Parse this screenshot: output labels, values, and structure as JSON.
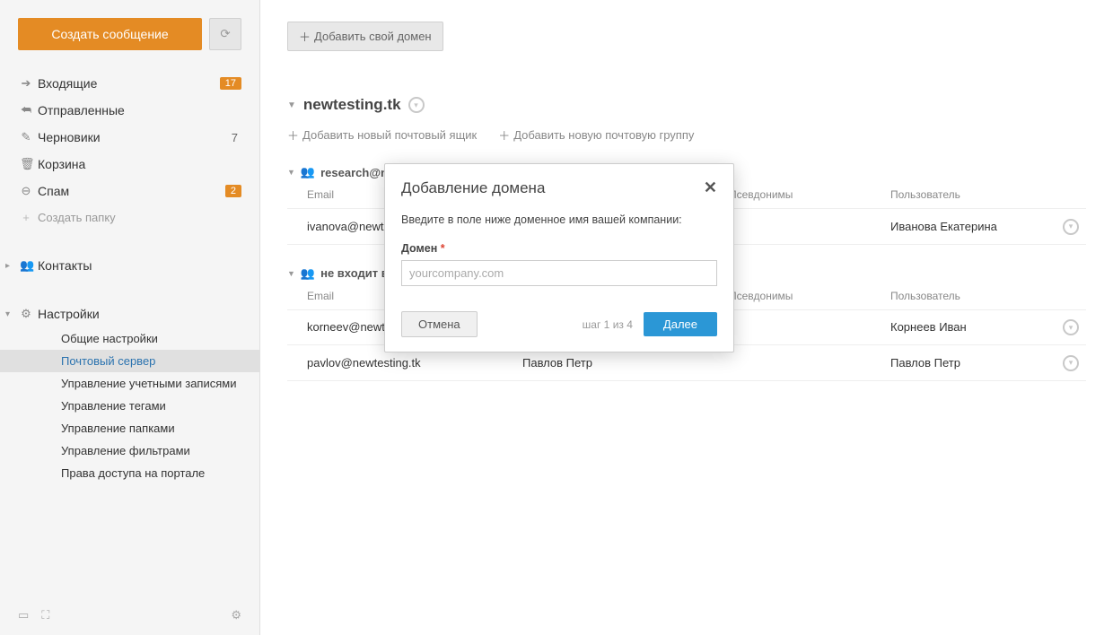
{
  "sidebar": {
    "compose_label": "Создать сообщение",
    "folders": [
      {
        "label": "Входящие",
        "badge": "17",
        "icon": "➡"
      },
      {
        "label": "Отправленные",
        "icon": "↩"
      },
      {
        "label": "Черновики",
        "count": "7",
        "icon": "✎"
      },
      {
        "label": "Корзина",
        "icon": "🗑"
      },
      {
        "label": "Спам",
        "badge": "2",
        "icon": "⊖"
      }
    ],
    "create_folder_label": "Создать папку",
    "contacts_label": "Контакты",
    "settings_label": "Настройки",
    "settings_items": [
      "Общие настройки",
      "Почтовый сервер",
      "Управление учетными записями",
      "Управление тегами",
      "Управление папками",
      "Управление фильтрами",
      "Права доступа на портале"
    ]
  },
  "content": {
    "add_domain_btn": "Добавить свой домен",
    "domain_title": "newtesting.tk",
    "add_mailbox_label": "Добавить новый почтовый ящик",
    "add_group_label": "Добавить новую почтовую группу",
    "columns": {
      "email": "Email",
      "pseudonyms": "Псевдонимы",
      "user": "Пользователь"
    },
    "group1_label": "research@ne",
    "group1_rows": [
      {
        "email": "ivanova@newtes",
        "name": "",
        "user": "Иванова Екатерина"
      }
    ],
    "group2_label": "не входит в",
    "group2_rows": [
      {
        "email": "korneev@newte",
        "name": "",
        "user": "Корнеев Иван"
      },
      {
        "email": "pavlov@newtesting.tk",
        "name": "Павлов Петр",
        "user": "Павлов Петр"
      }
    ]
  },
  "modal": {
    "title": "Добавление домена",
    "description": "Введите в поле ниже доменное имя вашей компании:",
    "field_label": "Домен",
    "placeholder": "yourcompany.com",
    "cancel_label": "Отмена",
    "step_text": "шаг 1 из 4",
    "next_label": "Далее"
  }
}
